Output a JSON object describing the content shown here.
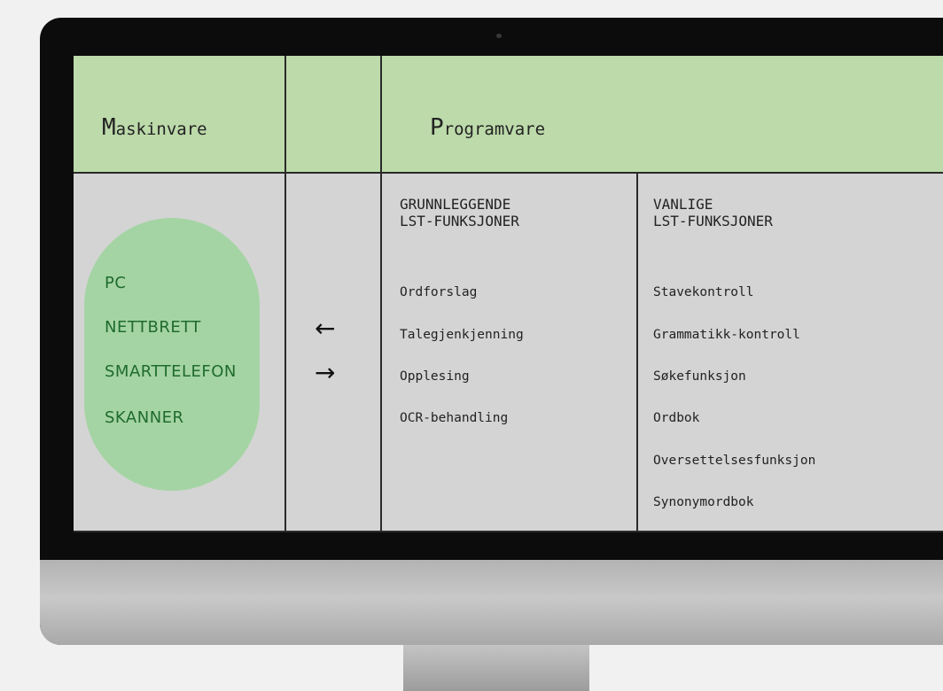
{
  "header": {
    "hardware_first": "M",
    "hardware_rest": "askinvare",
    "software_first": "P",
    "software_rest": "rogramvare"
  },
  "hardware_items": [
    "PC",
    "NETTBRETT",
    "SMARTTELEFON",
    "SKANNER"
  ],
  "arrows": {
    "left": "←",
    "right": "→"
  },
  "basic": {
    "heading_line1": "GRUNNLEGGENDE",
    "heading_line2": "LST-FUNKSJONER",
    "items": [
      "Ordforslag",
      "Talegjenkjenning",
      "Opplesing",
      "OCR-behandling"
    ]
  },
  "common": {
    "heading_line1": "VANLIGE",
    "heading_line2": "LST-FUNKSJONER",
    "items": [
      "Stavekontroll",
      "Grammatikk-kontroll",
      "Søkefunksjon",
      "Ordbok",
      "Oversettelsesfunksjon",
      "Synonymordbok"
    ]
  },
  "colors": {
    "header_green": "#bddaaa",
    "bubble_green": "#a5d4a4",
    "hardware_text": "#1f6b2d",
    "screen_grey": "#d4d4d4",
    "bezel": "#0c0c0c"
  }
}
